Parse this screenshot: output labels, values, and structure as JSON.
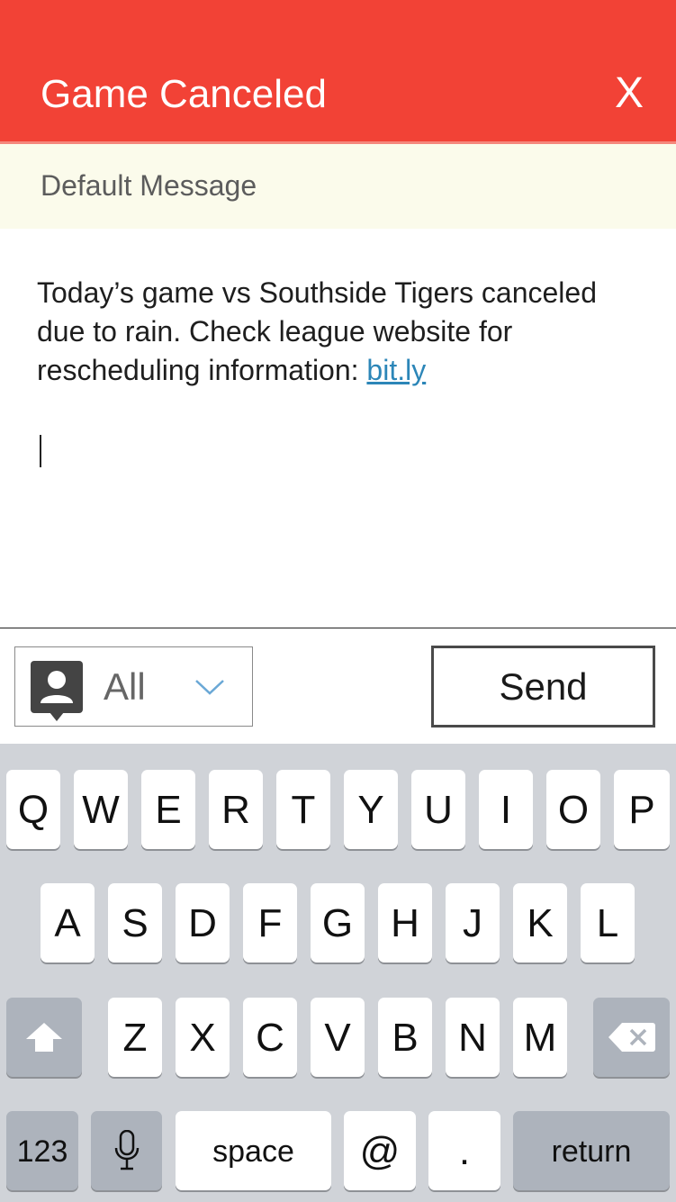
{
  "header": {
    "title": "Game Canceled",
    "close_label": "X"
  },
  "template": {
    "label": "Default Message"
  },
  "message": {
    "text": "Today’s game vs Southside Tigers canceled due to rain. Check league website for rescheduling information: ",
    "link_text": "bit.ly"
  },
  "recipient": {
    "label": "All",
    "icon": "contact-icon"
  },
  "send_label": "Send",
  "keyboard": {
    "row1": [
      "Q",
      "W",
      "E",
      "R",
      "T",
      "Y",
      "U",
      "I",
      "O",
      "P"
    ],
    "row2": [
      "A",
      "S",
      "D",
      "F",
      "G",
      "H",
      "J",
      "K",
      "L"
    ],
    "row3": [
      "Z",
      "X",
      "C",
      "V",
      "B",
      "N",
      "M"
    ],
    "numbers_label": "123",
    "space_label": "space",
    "at_label": "@",
    "period_label": ".",
    "return_label": "return"
  },
  "colors": {
    "accent": "#f24236",
    "link": "#2c86b8",
    "subheader_bg": "#fbfbeb",
    "keyboard_bg": "#d0d3d8"
  }
}
